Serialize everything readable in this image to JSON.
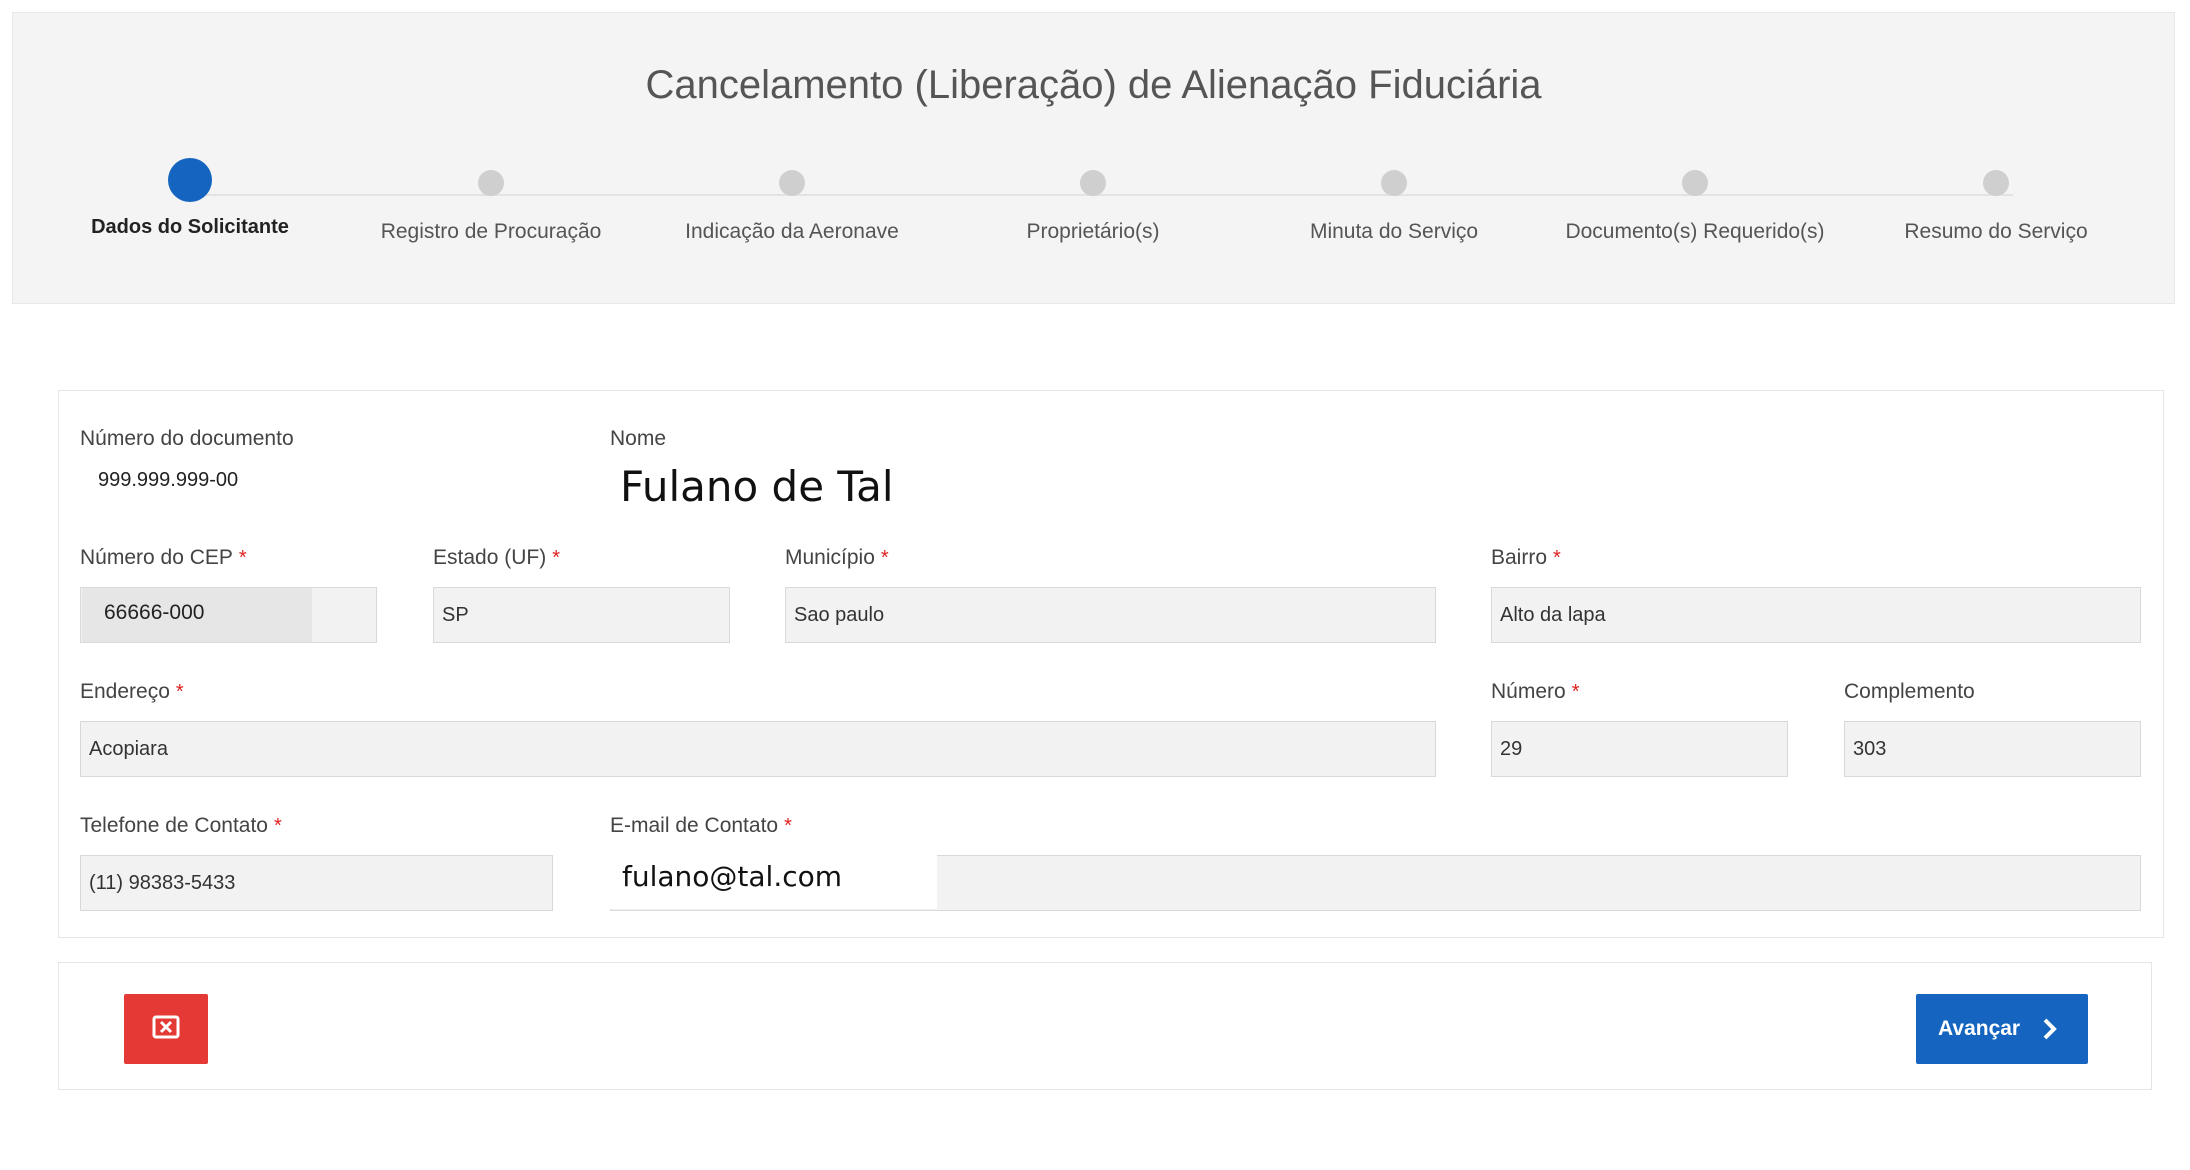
{
  "title": "Cancelamento (Liberação) de Alienação Fiduciária",
  "steps": [
    {
      "label": "Dados do Solicitante",
      "active": true
    },
    {
      "label": "Registro de Procuração",
      "active": false
    },
    {
      "label": "Indicação da Aeronave",
      "active": false
    },
    {
      "label": "Proprietário(s)",
      "active": false
    },
    {
      "label": "Minuta do Serviço",
      "active": false
    },
    {
      "label": "Documento(s) Requerido(s)",
      "active": false
    },
    {
      "label": "Resumo do Serviço",
      "active": false
    }
  ],
  "form": {
    "documento_label": "Número do documento",
    "documento_value": "999.999.999-00",
    "nome_label": "Nome",
    "nome_value": "Fulano de Tal",
    "cep_label": "Número do CEP",
    "cep_value": "66666-000",
    "estado_label": "Estado (UF)",
    "estado_value": "SP",
    "municipio_label": "Município",
    "municipio_value": "Sao paulo",
    "bairro_label": "Bairro",
    "bairro_value": "Alto da lapa",
    "endereco_label": "Endereço",
    "endereco_value": "Acopiara",
    "numero_label": "Número",
    "numero_value": "29",
    "complemento_label": "Complemento",
    "complemento_value": "303",
    "telefone_label": "Telefone de Contato",
    "telefone_value": "(11) 98383-5433",
    "email_label": "E-mail de Contato",
    "email_value": "fulano@tal.com",
    "required_mark": "*"
  },
  "actions": {
    "next_label": "Avançar",
    "cancel_icon": "close-box-icon",
    "next_icon": "chevron-right-icon"
  },
  "colors": {
    "primary": "#1565c0",
    "danger": "#e53935",
    "required": "#e02020"
  }
}
